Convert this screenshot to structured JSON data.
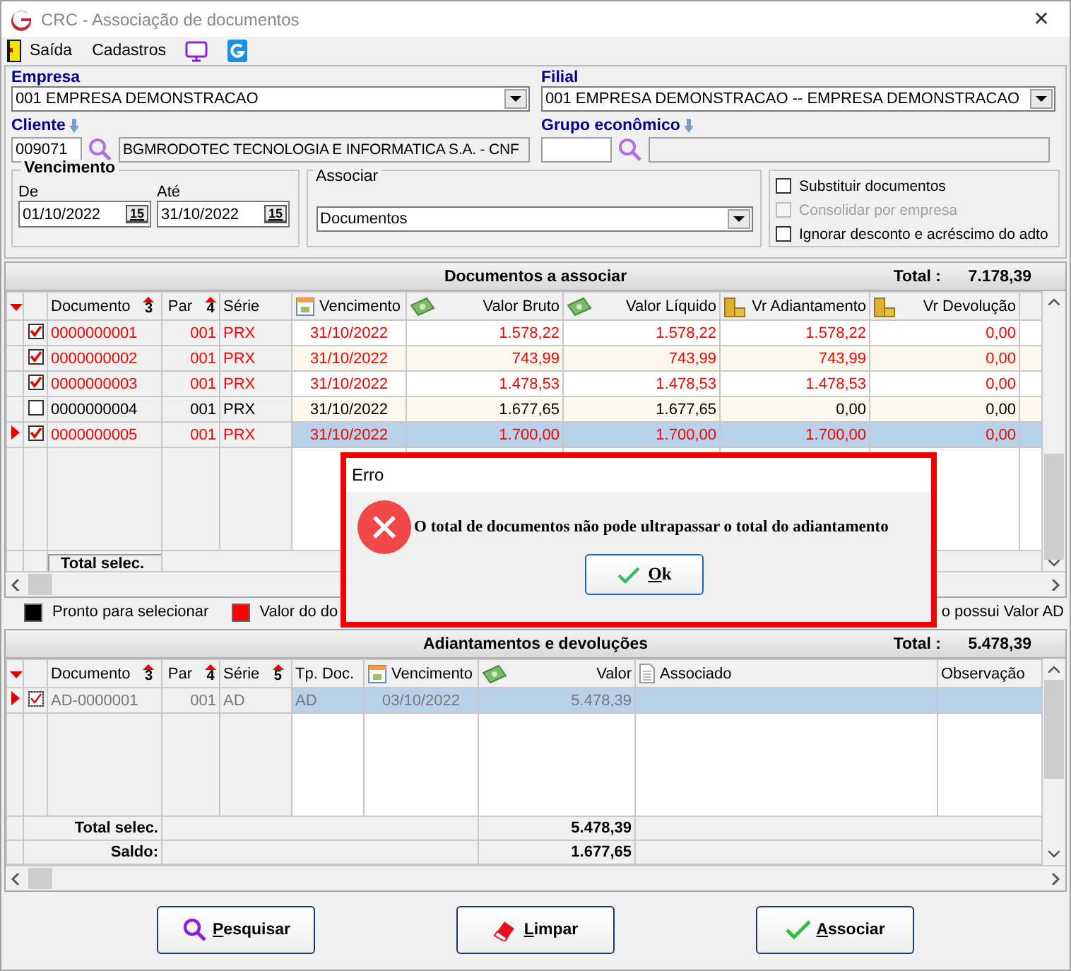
{
  "window": {
    "title": "CRC - Associação de documentos",
    "close": "✕"
  },
  "menu": [
    {
      "label": "Saída",
      "kind": "door"
    },
    {
      "label": "Cadastros",
      "kind": "text"
    },
    {
      "kind": "monitor"
    },
    {
      "kind": "logo"
    }
  ],
  "empresa": {
    "label": "Empresa",
    "value": "001 EMPRESA DEMONSTRACAO"
  },
  "filial": {
    "label": "Filial",
    "value": "001 EMPRESA DEMONSTRACAO -- EMPRESA DEMONSTRACAO"
  },
  "cliente": {
    "label": "Cliente",
    "code": "009071",
    "name": "BGMRODOTEC TECNOLOGIA E INFORMATICA S.A. - CNF"
  },
  "grupo": {
    "label": "Grupo econômico"
  },
  "vencimento": {
    "label": "Vencimento",
    "from": {
      "label": "De",
      "value": "01/10/2022",
      "calendar": "15"
    },
    "to": {
      "label": "Até",
      "value": "31/10/2022",
      "calendar": "15"
    }
  },
  "associar": {
    "label": "Associar",
    "value": "Documentos"
  },
  "options": [
    {
      "label": "Substituir documentos",
      "checked": false,
      "disabled": false
    },
    {
      "label": "Consolidar por empresa",
      "checked": false,
      "disabled": true
    },
    {
      "label": "Ignorar desconto e acréscimo do adto",
      "checked": false,
      "disabled": false
    }
  ],
  "documents": {
    "title": "Documentos a associar",
    "total_label": "Total :",
    "total": "7.178,39",
    "columns": [
      {
        "label": "Documento",
        "sort": "3",
        "kind": "text"
      },
      {
        "label": "Par",
        "sort": "4",
        "kind": "text"
      },
      {
        "label": "Série",
        "kind": "text"
      },
      {
        "label": "Vencimento",
        "kind": "date"
      },
      {
        "label": "Valor Bruto",
        "kind": "money"
      },
      {
        "label": "Valor Líquido",
        "kind": "money"
      },
      {
        "label": "Vr Adiantamento",
        "kind": "coins"
      },
      {
        "label": "Vr Devolução",
        "kind": "coins"
      }
    ],
    "rows": [
      {
        "checked": true,
        "selected": false,
        "color": "#ff0000",
        "cells": [
          "0000000001",
          "001",
          "PRX",
          "31/10/2022",
          "1.578,22",
          "1.578,22",
          "1.578,22",
          "0,00"
        ]
      },
      {
        "checked": true,
        "selected": false,
        "color": "#ff0000",
        "cells": [
          "0000000002",
          "001",
          "PRX",
          "31/10/2022",
          "743,99",
          "743,99",
          "743,99",
          "0,00"
        ]
      },
      {
        "checked": true,
        "selected": false,
        "color": "#ff0000",
        "cells": [
          "0000000003",
          "001",
          "PRX",
          "31/10/2022",
          "1.478,53",
          "1.478,53",
          "1.478,53",
          "0,00"
        ]
      },
      {
        "checked": false,
        "selected": false,
        "color": "#000000",
        "cells": [
          "0000000004",
          "001",
          "PRX",
          "31/10/2022",
          "1.677,65",
          "1.677,65",
          "0,00",
          "0,00"
        ]
      },
      {
        "checked": true,
        "selected": true,
        "color": "#ff0000",
        "cells": [
          "0000000005",
          "001",
          "PRX",
          "31/10/2022",
          "1.700,00",
          "1.700,00",
          "1.700,00",
          "0,00"
        ]
      }
    ],
    "total_selec": "Total selec."
  },
  "legend": [
    {
      "label": "Pronto para selecionar",
      "color": "#000000"
    },
    {
      "label": "Valor do do",
      "color": "#ff0000"
    },
    {
      "label": "o possui Valor AD"
    }
  ],
  "advances": {
    "title": "Adiantamentos e devoluções",
    "total_label": "Total :",
    "total": "5.478,39",
    "columns": [
      {
        "label": "Documento",
        "sort": "3",
        "kind": "text"
      },
      {
        "label": "Par",
        "sort": "4",
        "kind": "text"
      },
      {
        "label": "Série",
        "sort": "5",
        "kind": "text"
      },
      {
        "label": "Tp. Doc.",
        "kind": "text"
      },
      {
        "label": "Vencimento",
        "kind": "date"
      },
      {
        "label": "Valor",
        "kind": "money"
      },
      {
        "label": "Associado",
        "kind": "document"
      },
      {
        "label": "Observação",
        "kind": "text"
      }
    ],
    "rows": [
      {
        "checked": true,
        "selected": true,
        "cells": [
          "AD-0000001",
          "001",
          "AD",
          "AD",
          "03/10/2022",
          "5.478,39"
        ]
      }
    ],
    "total_selec_label": "Total selec.",
    "total_selec": "5.478,39",
    "saldo_label": "Saldo:",
    "saldo": "1.677,65"
  },
  "buttons": [
    {
      "label": "Pesquisar",
      "kind": "search"
    },
    {
      "label": "Limpar",
      "kind": "eraser"
    },
    {
      "label": "Associar",
      "kind": "check"
    }
  ],
  "dialog": {
    "title": "Erro",
    "message": "O total de documentos não pode ultrapassar o total do adiantamento",
    "button": "Ok"
  }
}
